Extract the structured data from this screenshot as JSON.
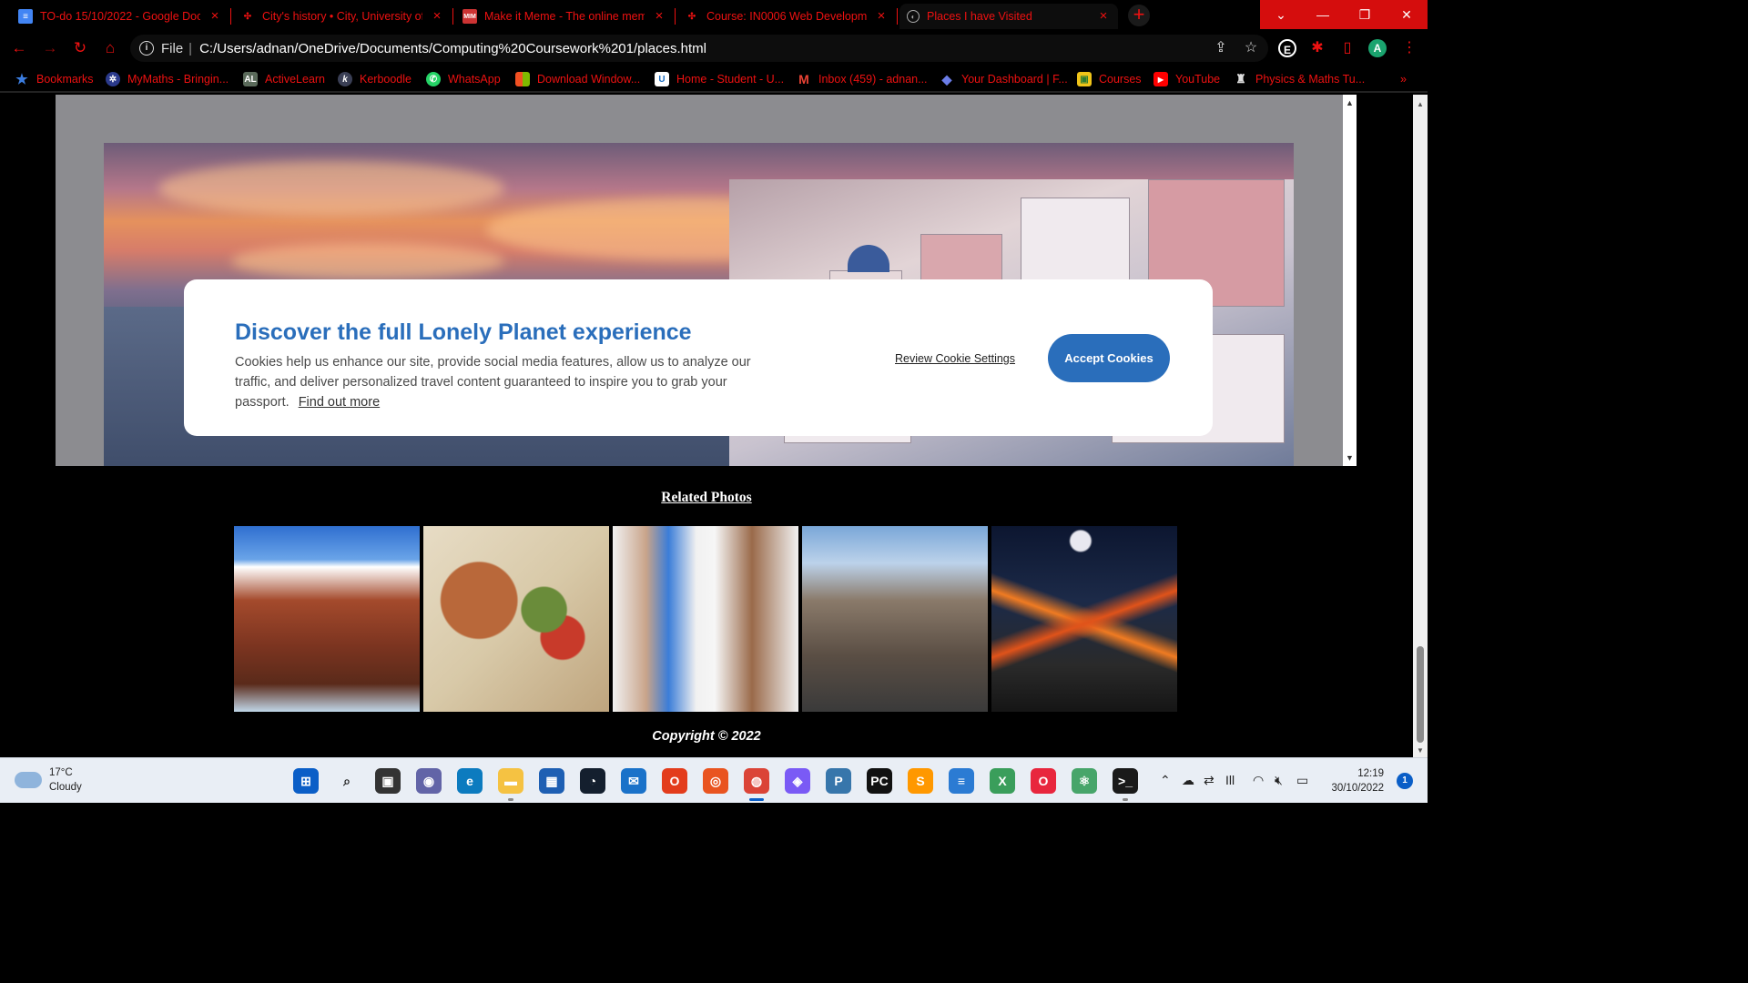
{
  "browser": {
    "tabs": [
      {
        "title": "TO-do 15/10/2022 - Google Doc",
        "favicon": "google-docs-icon",
        "color": "#4285f4"
      },
      {
        "title": "City's history • City, University of",
        "favicon": "city-university-icon",
        "color": "#c00"
      },
      {
        "title": "Make it Meme - The online mem",
        "favicon": "makeitmeme-icon",
        "color": "#c33"
      },
      {
        "title": "Course: IN0006 Web Developme",
        "favicon": "moodle-icon",
        "color": "#c00"
      },
      {
        "title": "Places I have Visited",
        "favicon": "globe-icon",
        "color": "#888"
      }
    ],
    "address": {
      "scheme": "File",
      "url": "C:/Users/adnan/OneDrive/Documents/Computing%20Coursework%201/places.html"
    },
    "extensions": [
      {
        "label": "E",
        "bg": "#1e8e3e"
      },
      {
        "label": "A",
        "bg": "#1aa36e"
      }
    ],
    "bookmarks": [
      {
        "label": "Bookmarks",
        "icon": "star-icon"
      },
      {
        "label": "MyMaths - Bringin...",
        "icon": "mymaths-icon"
      },
      {
        "label": "ActiveLearn",
        "icon": "activelearn-icon",
        "glyph": "AL"
      },
      {
        "label": "Kerboodle",
        "icon": "kerboodle-icon",
        "glyph": "k"
      },
      {
        "label": "WhatsApp",
        "icon": "whatsapp-icon"
      },
      {
        "label": "Download Window...",
        "icon": "windows-icon"
      },
      {
        "label": "Home - Student - U...",
        "icon": "unifrog-icon",
        "glyph": "U"
      },
      {
        "label": "Inbox (459) - adnan...",
        "icon": "gmail-icon",
        "glyph": "M"
      },
      {
        "label": "Your Dashboard | F...",
        "icon": "dashboard-icon"
      },
      {
        "label": "Courses",
        "icon": "courses-icon"
      },
      {
        "label": "YouTube",
        "icon": "youtube-icon"
      },
      {
        "label": "Physics & Maths Tu...",
        "icon": "pmt-icon"
      }
    ]
  },
  "cookie_banner": {
    "title": "Discover the full Lonely Planet experience",
    "body": "Cookies help us enhance our site, provide social media features, allow us to analyze our traffic, and deliver personalized travel content guaranteed to inspire you to grab your passport.",
    "find_more": "Find out more",
    "review_label": "Review Cookie Settings",
    "accept_label": "Accept Cookies",
    "accent": "#2a6ebb"
  },
  "page": {
    "related_title": "Related Photos",
    "photos": [
      {
        "subject": "red-beach",
        "colors": [
          "#2f6fd0",
          "#a44a2c",
          "#5a2a1a"
        ]
      },
      {
        "subject": "gyros-wrap",
        "colors": [
          "#d8c9a8",
          "#b9683a",
          "#6a8c3a"
        ]
      },
      {
        "subject": "alley-shops",
        "colors": [
          "#f1f1f1",
          "#3b7dd8",
          "#9a6a4a"
        ]
      },
      {
        "subject": "donkeys-cliff",
        "colors": [
          "#7aa7d8",
          "#8a7a6a",
          "#3a3a3a"
        ]
      },
      {
        "subject": "volcano-eruption",
        "colors": [
          "#0c1630",
          "#e0531a",
          "#2a2a2a"
        ]
      }
    ],
    "copyright": "Copyright © 2022"
  },
  "taskbar": {
    "weather_temp": "17°C",
    "weather_desc": "Cloudy",
    "time": "12:19",
    "date": "30/10/2022",
    "notifications": "1",
    "apps": [
      {
        "name": "start-icon",
        "bg": "#0a5ec7",
        "glyph": "⊞"
      },
      {
        "name": "search-icon",
        "bg": "transparent",
        "glyph": "⌕"
      },
      {
        "name": "task-view-icon",
        "bg": "#333",
        "glyph": "▣"
      },
      {
        "name": "teams-chat-icon",
        "bg": "#6264a7",
        "glyph": "◉"
      },
      {
        "name": "edge-icon",
        "bg": "#0c7bbf",
        "glyph": "e"
      },
      {
        "name": "file-explorer-icon",
        "bg": "#f5c242",
        "glyph": "▬"
      },
      {
        "name": "store-icon",
        "bg": "#1e5fb3",
        "glyph": "▦"
      },
      {
        "name": "speedtest-icon",
        "bg": "#141f2e",
        "glyph": "◔"
      },
      {
        "name": "mail-icon",
        "bg": "#1a72c9",
        "glyph": "✉"
      },
      {
        "name": "office-icon",
        "bg": "#e33c1c",
        "glyph": "O"
      },
      {
        "name": "ubuntu-icon",
        "bg": "#e95420",
        "glyph": "◎"
      },
      {
        "name": "chrome-icon",
        "bg": "#db4437",
        "glyph": "◍"
      },
      {
        "name": "brave-icon",
        "bg": "#7a5af5",
        "glyph": "◈"
      },
      {
        "name": "python-icon",
        "bg": "#3776ab",
        "glyph": "P"
      },
      {
        "name": "pycharm-icon",
        "bg": "#111",
        "glyph": "PC"
      },
      {
        "name": "sublime-icon",
        "bg": "#ff9800",
        "glyph": "S"
      },
      {
        "name": "notepad-icon",
        "bg": "#2b7bd3",
        "glyph": "≡"
      },
      {
        "name": "xcode-icon",
        "bg": "#3a9e5b",
        "glyph": "X"
      },
      {
        "name": "opera-icon",
        "bg": "#e8263d",
        "glyph": "O"
      },
      {
        "name": "atom-icon",
        "bg": "#47a56a",
        "glyph": "⚛"
      },
      {
        "name": "terminal-icon",
        "bg": "#1a1a1a",
        "glyph": ">_"
      }
    ]
  }
}
